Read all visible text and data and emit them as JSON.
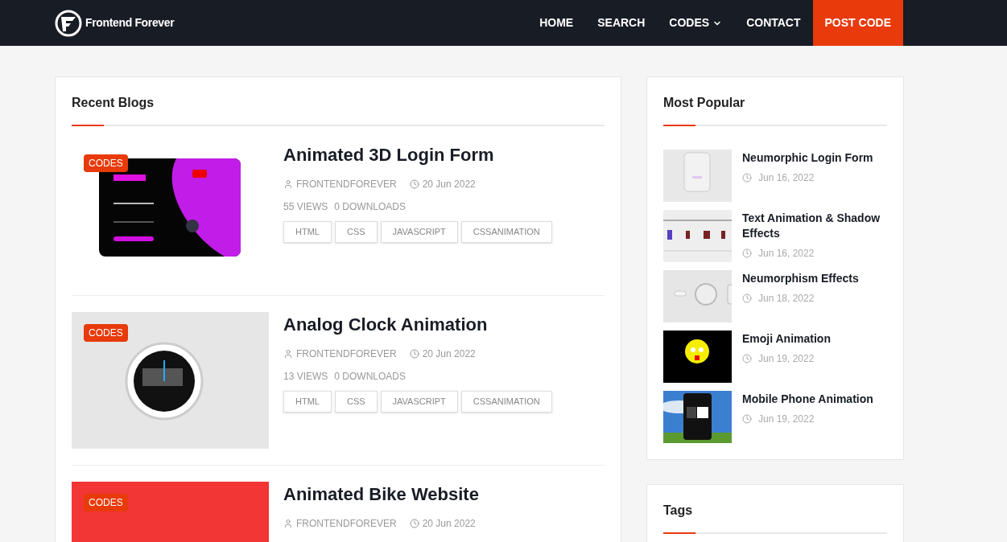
{
  "nav": {
    "logo": "Frontend Forever",
    "items": [
      {
        "label": "HOME",
        "kind": "link"
      },
      {
        "label": "SEARCH",
        "kind": "link"
      },
      {
        "label": "CODES",
        "kind": "dropdown"
      },
      {
        "label": "CONTACT",
        "kind": "link"
      },
      {
        "label": "POST CODE",
        "kind": "cta"
      }
    ]
  },
  "recent": {
    "title": "Recent Blogs",
    "posts": [
      {
        "category": "CODES",
        "title": "Animated 3D Login Form",
        "author": "FRONTENDFOREVER",
        "date": "20 Jun 2022",
        "views": "55 VIEWS",
        "downloads": "0 DOWNLOADS",
        "tags": [
          "HTML",
          "CSS",
          "JAVASCRIPT",
          "CSSANIMATION"
        ],
        "image": {
          "kind": "picture"
        }
      },
      {
        "category": "CODES",
        "title": "Analog Clock Animation",
        "author": "FRONTENDFOREVER",
        "date": "20 Jun 2022",
        "views": "13 VIEWS",
        "downloads": "0 DOWNLOADS",
        "tags": [
          "HTML",
          "CSS",
          "JAVASCRIPT",
          "CSSANIMATION"
        ],
        "image": {
          "kind": "picture"
        }
      },
      {
        "category": "CODES",
        "title": "Animated Bike Website",
        "author": "FRONTENDFOREVER",
        "date": "20 Jun 2022",
        "image": {
          "kind": "picture"
        }
      }
    ]
  },
  "popular": {
    "title": "Most Popular",
    "items": [
      {
        "title": "Neumorphic Login Form",
        "date": "Jun 16, 2022",
        "image": {
          "kind": "picture"
        }
      },
      {
        "title": "Text Animation & Shadow Effects",
        "date": "Jun 16, 2022",
        "image": {
          "kind": "picture"
        }
      },
      {
        "title": "Neumorphism Effects",
        "date": "Jun 18, 2022",
        "image": {
          "kind": "picture"
        }
      },
      {
        "title": "Emoji Animation",
        "date": "Jun 19, 2022",
        "image": {
          "kind": "picture"
        }
      },
      {
        "title": "Mobile Phone Animation",
        "date": "Jun 19, 2022",
        "image": {
          "kind": "picture"
        }
      }
    ]
  },
  "tags": {
    "title": "Tags"
  }
}
